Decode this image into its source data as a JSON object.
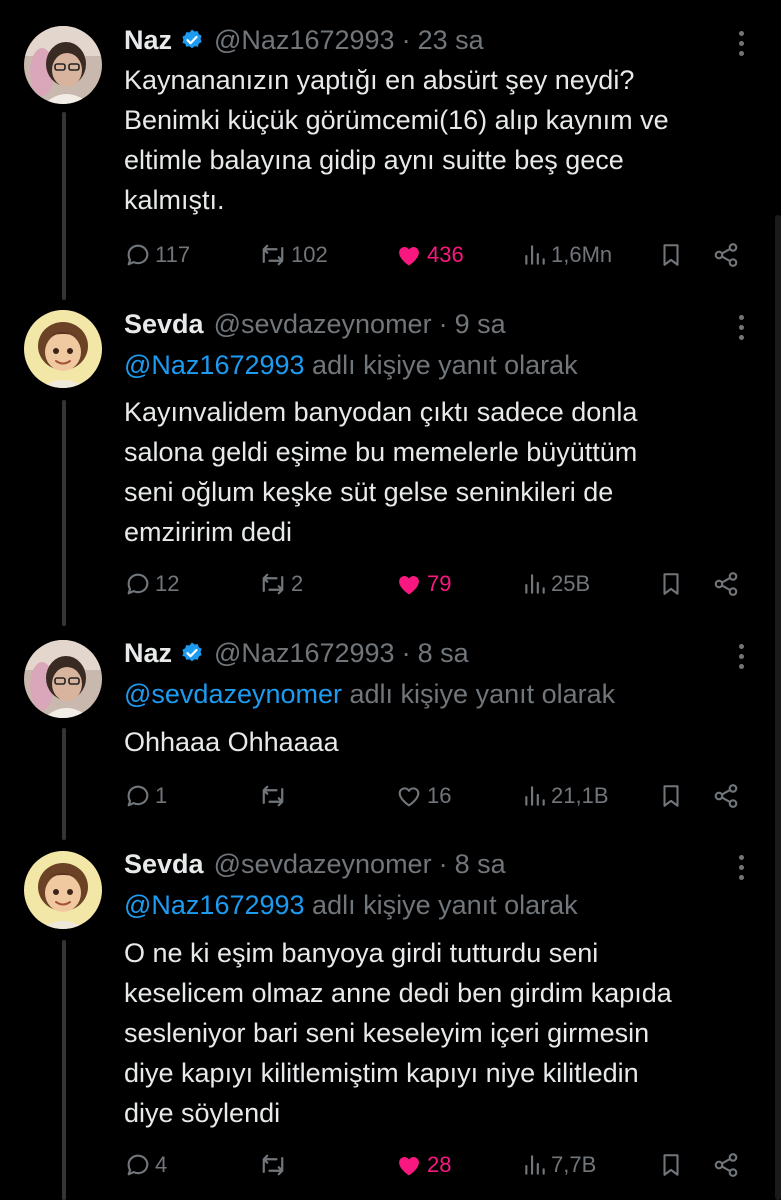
{
  "tweets": [
    {
      "name": "Naz",
      "verified": true,
      "handle": "@Naz1672993",
      "time": "23 sa",
      "reply_prefix": "",
      "reply_suffix": "",
      "lines": [
        "Kaynananızın yaptığı en absürt şey neydi?",
        "Benimki küçük görümcemi(16) alıp kaynım ve",
        "eltimle balayına gidip aynı suitte beş gece",
        "kalmıştı."
      ],
      "replies": "117",
      "retweets": "102",
      "likes": "436",
      "liked": true,
      "views": "1,6Mn"
    },
    {
      "name": "Sevda",
      "verified": false,
      "handle": "@sevdazeynomer",
      "time": "9 sa",
      "reply_prefix": "@Naz1672993",
      "reply_suffix": " adlı kişiye yanıt olarak",
      "lines": [
        "Kayınvalidem banyodan çıktı sadece donla",
        "salona geldi eşime bu memelerle büyüttüm",
        "seni oğlum keşke süt gelse seninkileri de",
        "emziririm dedi"
      ],
      "replies": "12",
      "retweets": "2",
      "likes": "79",
      "liked": true,
      "views": "25B"
    },
    {
      "name": "Naz",
      "verified": true,
      "handle": "@Naz1672993",
      "time": "8 sa",
      "reply_prefix": "@sevdazeynomer",
      "reply_suffix": " adlı kişiye yanıt olarak",
      "lines": [
        "Ohhaaa Ohhaaaa"
      ],
      "replies": "1",
      "retweets": "",
      "likes": "16",
      "liked": false,
      "views": "21,1B"
    },
    {
      "name": "Sevda",
      "verified": false,
      "handle": "@sevdazeynomer",
      "time": "8 sa",
      "reply_prefix": "@Naz1672993",
      "reply_suffix": " adlı kişiye yanıt olarak",
      "lines": [
        "O ne ki eşim banyoya girdi tutturdu seni",
        "keselicem olmaz anne dedi ben girdim kapıda",
        "sesleniyor bari seni keseleyim içeri girmesin",
        "diye kapıyı kilitlemiştim kapıyı niye kilitledin",
        "diye söylendi"
      ],
      "replies": "4",
      "retweets": "",
      "likes": "28",
      "liked": true,
      "views": "7,7B"
    }
  ],
  "colors": {
    "background": "#000000",
    "text": "#e7e9ea",
    "muted": "#71767b",
    "link": "#1d9bf0",
    "like": "#f91880",
    "verified": "#1d9bf0"
  },
  "icons": {
    "reply": "speech-bubble-icon",
    "retweet": "retweet-arrows-icon",
    "like": "heart-icon",
    "views": "bar-chart-icon",
    "bookmark": "bookmark-icon",
    "share": "share-nodes-icon",
    "more": "vertical-dots-icon",
    "verified": "verified-badge-icon"
  }
}
